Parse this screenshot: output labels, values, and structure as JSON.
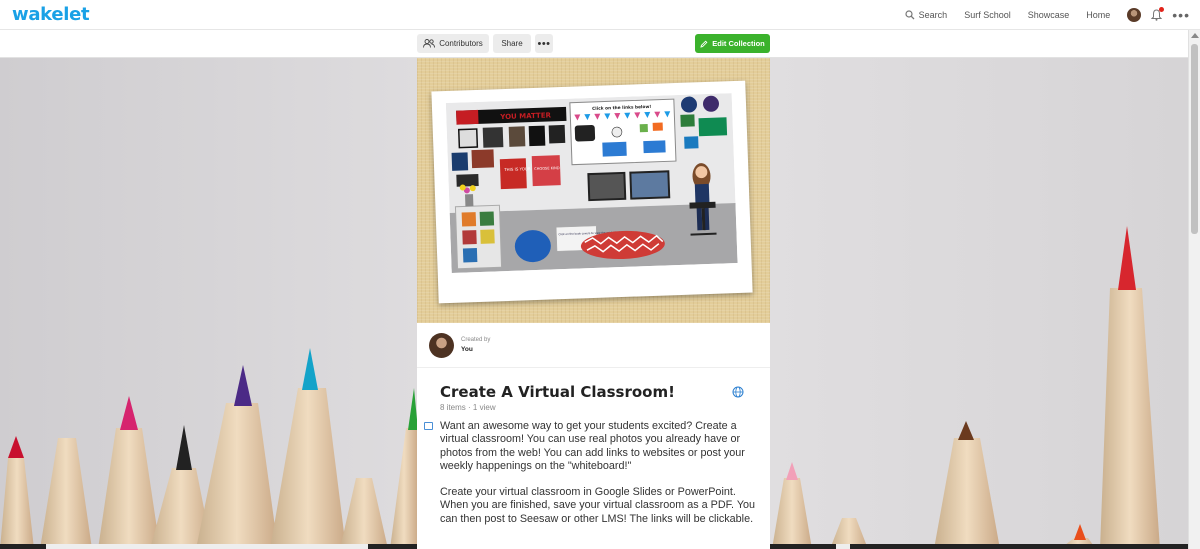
{
  "app": {
    "logo": "wakelet"
  },
  "nav": {
    "search_label": "Search",
    "surf_school": "Surf School",
    "showcase": "Showcase",
    "home": "Home"
  },
  "toolbar": {
    "contributors_label": "Contributors",
    "share_label": "Share",
    "more_label": "•••",
    "edit_label": "Edit Collection"
  },
  "collection": {
    "created_by_label": "Created by",
    "creator": "You",
    "title": "Create A Virtual Classroom!",
    "items_count": "8 items",
    "views": "1 view",
    "description": [
      "Want an awesome way to get your students excited? Create a virtual classroom! You can use real photos you already have or photos from the web! You can add links to websites or post your weekly happenings on the \"whiteboard!\"",
      "Create your virtual classroom in Google Slides or PowerPoint. When you are finished, save your virtual classroom as a PDF. You can then post to Seesaw or other LMS! The links will be clickable."
    ]
  },
  "cover_image": {
    "banner_text": "YOU MATTER",
    "whiteboard_text": "Click on the links below!",
    "poster_1": "THIS IS YOUR YEAR TO...",
    "poster_2": "CHOOSE KIND",
    "bean_bag_note": "Click on the book covers to view the read alouds!"
  },
  "colors": {
    "brand": "#1aa1e6",
    "edit_button": "#3bb22c",
    "notification": "#e2231a"
  }
}
